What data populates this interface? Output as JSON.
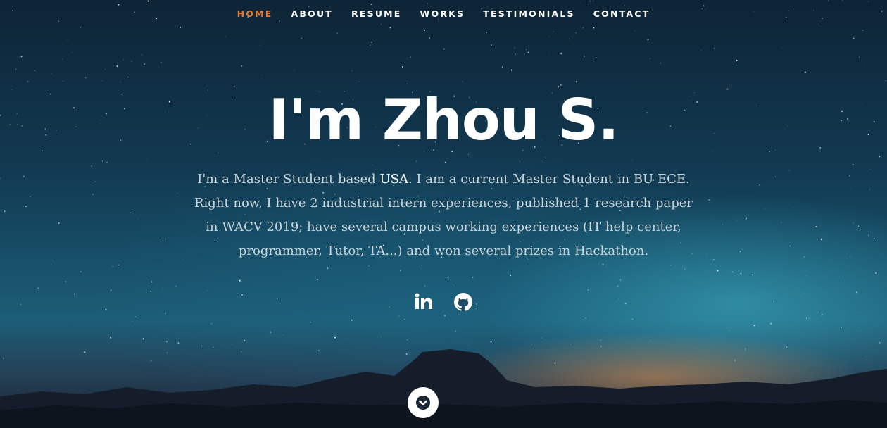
{
  "nav": {
    "items": [
      {
        "label": "HOME",
        "active": true
      },
      {
        "label": "ABOUT",
        "active": false
      },
      {
        "label": "RESUME",
        "active": false
      },
      {
        "label": "WORKS",
        "active": false
      },
      {
        "label": "TESTIMONIALS",
        "active": false
      },
      {
        "label": "CONTACT",
        "active": false
      }
    ],
    "active_color": "#e37a2c"
  },
  "hero": {
    "title": "I'm Zhou S.",
    "intro_before": "I'm a Master Student based ",
    "intro_highlight": "USA",
    "intro_after": ". I am a current Master Student in BU ECE. Right now, I have 2 industrial intern experiences, published 1 research paper in WACV 2019; have several campus working experiences (IT help center, programmer, Tutor, TA...) and won several prizes in Hackathon."
  },
  "social": [
    {
      "icon": "linkedin-icon"
    },
    {
      "icon": "github-icon"
    }
  ],
  "scroll_down": {
    "icon": "chevron-down-icon"
  }
}
